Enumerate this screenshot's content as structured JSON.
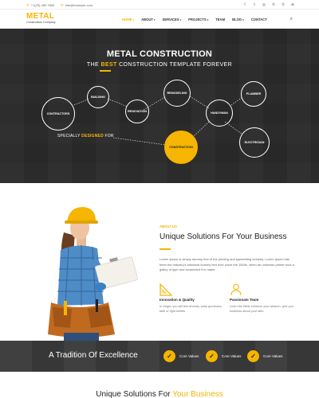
{
  "topbar": {
    "phone": "+1(23) 456 7890",
    "email": "info@example.com",
    "social_icons": [
      "facebook-icon",
      "twitter-icon",
      "instagram-icon",
      "pinterest-icon",
      "skype-icon",
      "dribbble-icon"
    ]
  },
  "brand": {
    "name": "METAL",
    "tagline": "Construction Company",
    "accent_color": "#f5b500"
  },
  "nav": {
    "items": [
      {
        "label": "HOME",
        "caret": "▾",
        "active": true
      },
      {
        "label": "ABOUT",
        "caret": "▾"
      },
      {
        "label": "SERVICES",
        "caret": "▾"
      },
      {
        "label": "PROJECTS",
        "caret": "▾"
      },
      {
        "label": "TEAM",
        "caret": ""
      },
      {
        "label": "BLOG",
        "caret": "▾"
      },
      {
        "label": "CONTACT",
        "caret": ""
      }
    ]
  },
  "hero": {
    "title": "METAL CONSTRUCTION",
    "subtitle_pre": "THE ",
    "subtitle_hl": "BEST",
    "subtitle_post": " CONSTRUCTION TEMPLATE FOREVER",
    "specially_pre": "SPECIALLY ",
    "specially_hl": "DESIGNED",
    "specially_post": " FOR",
    "nodes": {
      "contractors": "CONTRACTORS",
      "building": "BUILDING",
      "renovation": "RENOVATION",
      "remodeling": "REMODELING",
      "handyman": "HANDYMAN",
      "plumber": "PLUMBER",
      "electrician": "ELECTRICIAN",
      "construction": "CONSTRUCTION"
    }
  },
  "about": {
    "label": "ABOUT US",
    "heading": "Unique Solutions For Your Business",
    "text": "Lorem Ipsum is simply dummy text of the printing and typesetting industry. Lorem Ipsum has been the industry's standard dummy text ever since the 1500s, when an unknown printer took a galley of type and scrambled it to make.",
    "features": [
      {
        "icon": "ruler-triangle-icon",
        "title": "Innovation & Quality",
        "text": "In Degen you will feel divinely, party goodness, faith or right beliefs."
      },
      {
        "icon": "person-icon",
        "title": "Passionate Team",
        "text": "Learn the Bible enhance your wisdom, give you boldness about your faith."
      }
    ]
  },
  "strip": {
    "title": "A Tradition Of Excellence",
    "values": [
      "Core Values",
      "Core Values",
      "Core Values"
    ]
  },
  "bottom": {
    "heading_pre": "Unique Solutions For ",
    "heading_hl": "Your Business"
  }
}
